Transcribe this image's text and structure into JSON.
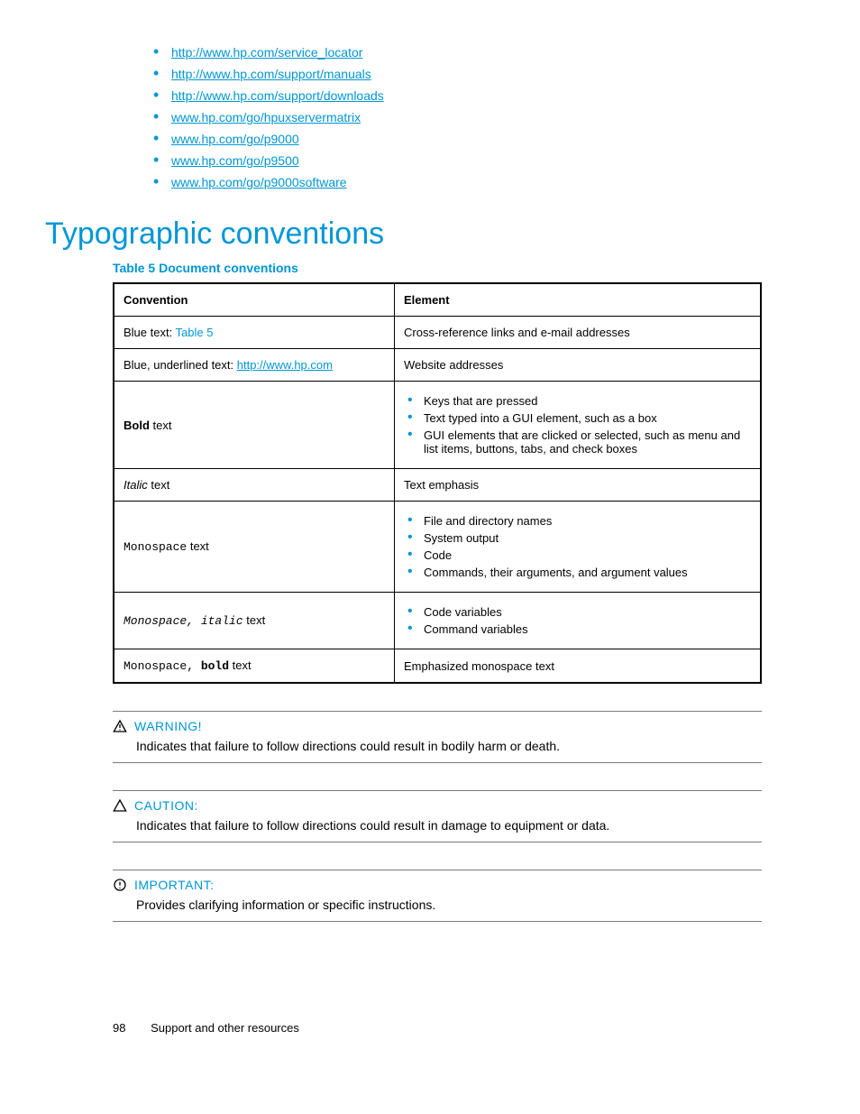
{
  "top_links": [
    "http://www.hp.com/service_locator",
    "http://www.hp.com/support/manuals",
    "http://www.hp.com/support/downloads",
    "www.hp.com/go/hpuxservermatrix",
    "www.hp.com/go/p9000",
    "www.hp.com/go/p9500",
    "www.hp.com/go/p9000software"
  ],
  "heading": "Typographic conventions",
  "table_caption": "Table 5 Document conventions",
  "table": {
    "headers": {
      "c1": "Convention",
      "c2": "Element"
    },
    "rows": {
      "r1": {
        "c1_prefix": "Blue text: ",
        "c1_link": "Table 5",
        "c2": "Cross-reference links and e-mail addresses"
      },
      "r2": {
        "c1_prefix": "Blue, underlined text: ",
        "c1_link": "http://www.hp.com",
        "c2": "Website addresses"
      },
      "r3": {
        "c1_bold": "Bold",
        "c1_rest": " text",
        "c2_items": [
          "Keys that are pressed",
          "Text typed into a GUI element, such as a box",
          "GUI elements that are clicked or selected, such as menu and list items, buttons, tabs, and check boxes"
        ]
      },
      "r4": {
        "c1_italic": "Italic",
        "c1_rest": "  text",
        "c2": "Text emphasis"
      },
      "r5": {
        "c1_mono": "Monospace",
        "c1_rest": "  text",
        "c2_items": [
          "File and directory names",
          "System output",
          "Code",
          "Commands, their arguments, and argument values"
        ]
      },
      "r6": {
        "c1_mono_italic": "Monospace, italic",
        "c1_rest": " text",
        "c2_items": [
          "Code variables",
          "Command variables"
        ]
      },
      "r7": {
        "c1_mono": "Monospace, ",
        "c1_mono_bold": "bold",
        "c1_rest": "  text",
        "c2": "Emphasized monospace text"
      }
    }
  },
  "notices": {
    "warning": {
      "label": "WARNING!",
      "body": "Indicates that failure to follow directions could result in bodily harm or death."
    },
    "caution": {
      "label": "CAUTION:",
      "body": "Indicates that failure to follow directions could result in damage to equipment or data."
    },
    "important": {
      "label": "IMPORTANT:",
      "body": "Provides clarifying information or specific instructions."
    }
  },
  "footer": {
    "page": "98",
    "section": "Support and other resources"
  }
}
